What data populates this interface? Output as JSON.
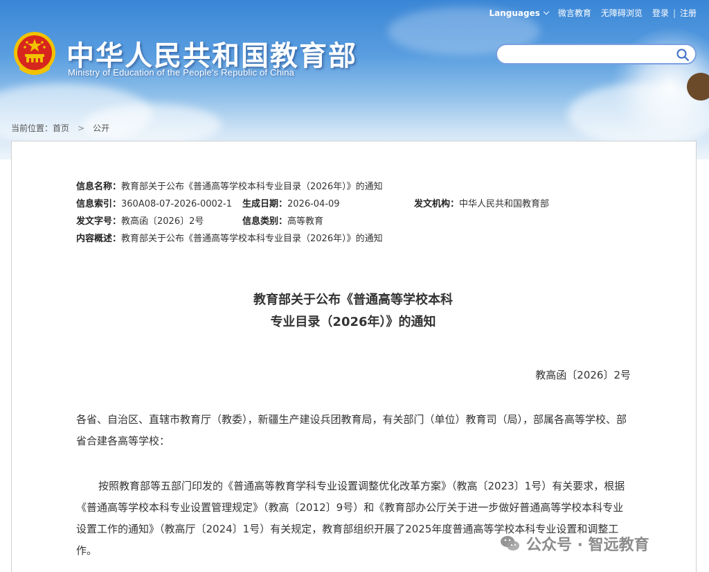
{
  "header": {
    "site_title": "中华人民共和国教育部",
    "site_subtitle": "Ministry of Education of the People's Republic of China",
    "links": {
      "languages": "Languages",
      "weibo": "微言教育",
      "accessible": "无障碍浏览",
      "login": "登录",
      "separator": "|",
      "register": "注册"
    },
    "search": {
      "placeholder": ""
    }
  },
  "breadcrumb": {
    "prefix": "当前位置：",
    "home": "首页",
    "separator": ">",
    "current": "公开"
  },
  "meta": {
    "name_label": "信息名称：",
    "name_value": "教育部关于公布《普通高等学校本科专业目录（2026年）》的通知",
    "index_label": "信息索引：",
    "index_value": "360A08-07-2026-0002-1",
    "date_label": "生成日期：",
    "date_value": "2026-04-09",
    "org_label": "发文机构：",
    "org_value": "中华人民共和国教育部",
    "docno_label": "发文字号：",
    "docno_value": "教高函〔2026〕2号",
    "category_label": "信息类别：",
    "category_value": "高等教育",
    "summary_label": "内容概述：",
    "summary_value": "教育部关于公布《普通高等学校本科专业目录（2026年）》的通知"
  },
  "document": {
    "title_line1": "教育部关于公布《普通高等学校本科",
    "title_line2": "专业目录（2026年）》的通知",
    "doc_number": "教高函〔2026〕2号",
    "paragraph_1": "各省、自治区、直辖市教育厅（教委），新疆生产建设兵团教育局，有关部门（单位）教育司（局），部属各高等学校、部省合建各高等学校：",
    "paragraph_2": "按照教育部等五部门印发的《普通高等教育学科专业设置调整优化改革方案》（教高〔2023〕1号）有关要求，根据《普通高等学校本科专业设置管理规定》（教高〔2012〕9号）和《教育部办公厅关于进一步做好普通高等学校本科专业设置工作的通知》（教高厅〔2024〕1号）有关规定，教育部组织开展了2025年度普通高等学校本科专业设置和调整工作。"
  },
  "watermark": {
    "text": "公众号 · 智远教育",
    "icon": "wechat-icon"
  },
  "colors": {
    "header_blue": "#3a86d6",
    "emblem_red": "#d7261e",
    "emblem_gold": "#f2c200",
    "search_border": "#7a9fe0"
  }
}
